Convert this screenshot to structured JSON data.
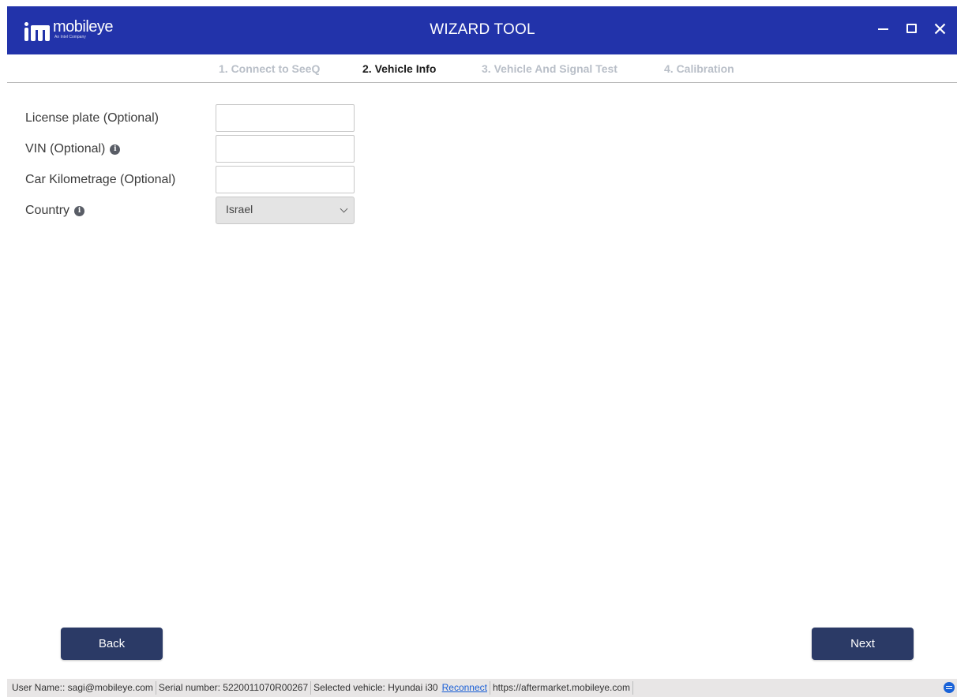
{
  "titlebar": {
    "logo_name": "mobileye",
    "logo_tag": "An Intel Company",
    "app_title": "WIZARD TOOL",
    "color": "#2233aa"
  },
  "steps": [
    {
      "label": "1. Connect to SeeQ",
      "active": false
    },
    {
      "label": "2. Vehicle Info",
      "active": true
    },
    {
      "label": "3. Vehicle And Signal Test",
      "active": false
    },
    {
      "label": "4. Calibration",
      "active": false
    }
  ],
  "form": {
    "license_plate": {
      "label": "License plate (Optional)",
      "value": ""
    },
    "vin": {
      "label": "VIN (Optional)",
      "value": "",
      "icon": "info-icon"
    },
    "kilometrage": {
      "label": "Car Kilometrage (Optional)",
      "value": ""
    },
    "country": {
      "label": "Country",
      "selected": "Israel",
      "icon": "info-icon"
    }
  },
  "buttons": {
    "back": "Back",
    "next": "Next",
    "color": "#2b3a66"
  },
  "statusbar": {
    "user": "User Name:: sagi@mobileye.com",
    "serial": "Serial number: 5220011070R00267",
    "vehicle": "Selected vehicle: Hyundai i30",
    "reconnect": "Reconnect",
    "url": "https://aftermarket.mobileye.com"
  }
}
